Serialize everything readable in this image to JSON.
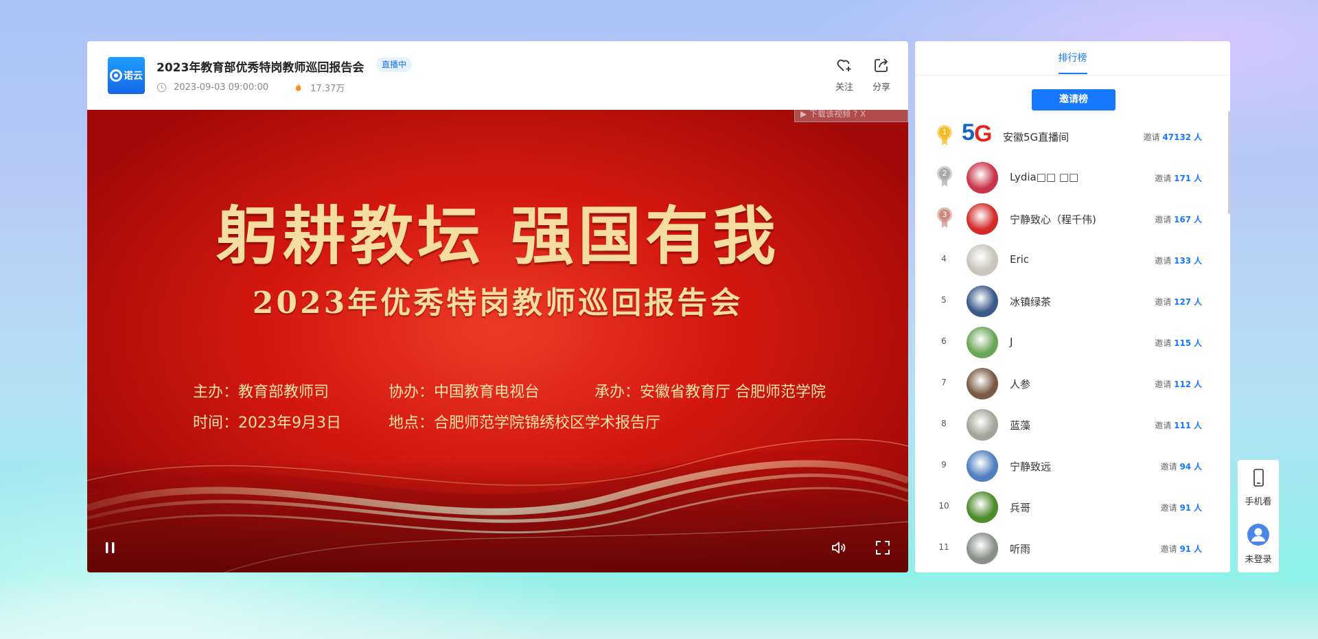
{
  "header": {
    "logo_text": "诺云",
    "title": "2023年教育部优秀特岗教师巡回报告会",
    "live_badge": "直播中",
    "datetime": "2023-09-03 09:00:00",
    "heat": "17.37万",
    "follow_label": "关注",
    "share_label": "分享"
  },
  "video": {
    "headline": "躬耕教坛  强国有我",
    "subhead": "2023年优秀特岗教师巡回报告会",
    "host": "主办：教育部教师司",
    "co_host": "协办：中国教育电视台",
    "organizer": "承办：安徽省教育厅   合肥师范学院",
    "time": "时间：2023年9月3日",
    "place": "地点：合肥师范学院锦绣校区学术报告厅",
    "download_tip": "▶ 下载该视频  ?  X",
    "controls": [
      "pause-icon",
      "volume-icon",
      "fullscreen-icon"
    ]
  },
  "ranking": {
    "tab_label": "排行榜",
    "invite_button": "邀请榜",
    "invite_prefix": "邀请",
    "unit": "人",
    "rows": [
      {
        "rank": "1",
        "name": "安徽5G直播间",
        "count": "47132",
        "medal": "gold",
        "avatar_color": "#ffffff"
      },
      {
        "rank": "2",
        "name": "Lydia□□ □□",
        "count": "171",
        "medal": "silver",
        "avatar_color": "#c9344a"
      },
      {
        "rank": "3",
        "name": "宁静致心（程千伟)",
        "count": "167",
        "medal": "bronze",
        "avatar_color": "#d42a2a"
      },
      {
        "rank": "4",
        "name": "Eric",
        "count": "133",
        "medal": "",
        "avatar_color": "#c9c5bd"
      },
      {
        "rank": "5",
        "name": "冰镇绿茶",
        "count": "127",
        "medal": "",
        "avatar_color": "#3b5a8a"
      },
      {
        "rank": "6",
        "name": "J",
        "count": "115",
        "medal": "",
        "avatar_color": "#6aa657"
      },
      {
        "rank": "7",
        "name": "人参",
        "count": "112",
        "medal": "",
        "avatar_color": "#7a5a44"
      },
      {
        "rank": "8",
        "name": "蓝藻",
        "count": "111",
        "medal": "",
        "avatar_color": "#a4a49a"
      },
      {
        "rank": "9",
        "name": "宁静致远",
        "count": "94",
        "medal": "",
        "avatar_color": "#4f7fbf"
      },
      {
        "rank": "10",
        "name": "兵哥",
        "count": "91",
        "medal": "",
        "avatar_color": "#4e8c2c"
      },
      {
        "rank": "11",
        "name": "听雨",
        "count": "91",
        "medal": "",
        "avatar_color": "#8a8f8a"
      }
    ]
  },
  "float_bar": {
    "mobile_label": "手机看",
    "login_label": "未登录"
  },
  "colors": {
    "accent": "#1677ff",
    "video_red": "#d3170f",
    "gold_text": "#f5dca0"
  }
}
